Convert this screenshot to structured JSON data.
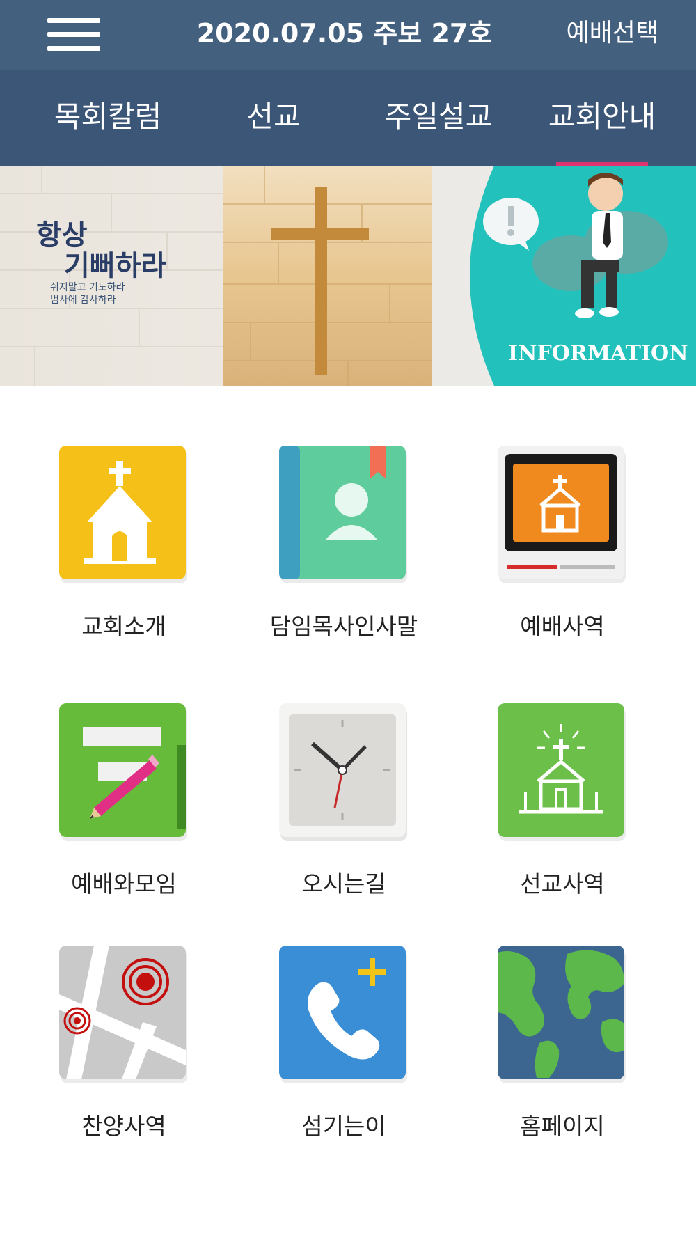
{
  "header": {
    "title": "2020.07.05 주보 27호",
    "right_button": "예배선택"
  },
  "tabs": [
    {
      "label": "목회칼럼",
      "active": false
    },
    {
      "label": "선교",
      "active": false
    },
    {
      "label": "주일설교",
      "active": false
    },
    {
      "label": "교회안내",
      "active": true
    }
  ],
  "banner": {
    "left_text_line1": "항상",
    "left_text_line2": "기뻐하라",
    "left_text_line3": "쉬지말고 기도하라",
    "left_text_line4": "범사에 감사하라",
    "right_text": "INFORMATION"
  },
  "menu": [
    {
      "label": "교회소개",
      "icon": "church-icon"
    },
    {
      "label": "담임목사인사말",
      "icon": "contact-book-icon"
    },
    {
      "label": "예배사역",
      "icon": "video-church-icon"
    },
    {
      "label": "예배와모임",
      "icon": "note-pencil-icon"
    },
    {
      "label": "오시는길",
      "icon": "clock-icon"
    },
    {
      "label": "선교사역",
      "icon": "church-light-icon"
    },
    {
      "label": "찬양사역",
      "icon": "map-pin-icon"
    },
    {
      "label": "섬기는이",
      "icon": "phone-add-icon"
    },
    {
      "label": "홈페이지",
      "icon": "globe-icon"
    }
  ],
  "colors": {
    "header": "#44607f",
    "tabbar": "#3c5677",
    "tab_indicator": "#e0326f",
    "info_teal": "#22c1bb"
  }
}
